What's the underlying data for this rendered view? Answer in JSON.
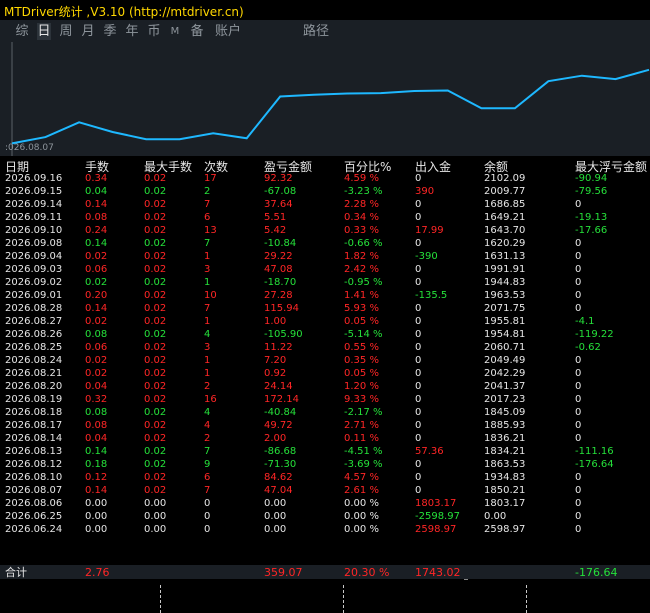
{
  "window": {
    "title": "MTDriver统计 ,V3.10 (http://mtdriver.cn)"
  },
  "tabs": [
    {
      "label": "综",
      "active": false
    },
    {
      "label": "日",
      "active": true
    },
    {
      "label": "周",
      "active": false
    },
    {
      "label": "月",
      "active": false
    },
    {
      "label": "季",
      "active": false
    },
    {
      "label": "年",
      "active": false
    },
    {
      "label": "币",
      "active": false
    },
    {
      "label": "M",
      "active": false
    },
    {
      "label": "备",
      "active": false
    },
    {
      "label": "账户",
      "active": false
    },
    {
      "label": "路径",
      "active": false
    }
  ],
  "chart": {
    "start_label": ":026.08.07",
    "line_color": "#1eb8ff",
    "y_min": -400,
    "y_max": 2200,
    "balance_series": [
      -150,
      0,
      350,
      120,
      -50,
      -50,
      90,
      -30,
      960,
      1000,
      1030,
      1040,
      1090,
      1100,
      680,
      680,
      1320,
      1450,
      1370,
      1590
    ]
  },
  "table": {
    "headers": [
      "日期",
      "手数",
      "最大手数",
      "次数",
      "盈亏金额",
      "百分比%",
      "出入金",
      "余额",
      "最大浮亏金额"
    ],
    "rows": [
      [
        "2026.09.16",
        "0.34",
        "0.02",
        "17",
        "92.32",
        "4.59 %",
        "0",
        "2102.09",
        "-90.94"
      ],
      [
        "2026.09.15",
        "0.04",
        "0.02",
        "2",
        "-67.08",
        "-3.23 %",
        "390",
        "2009.77",
        "-79.56"
      ],
      [
        "2026.09.14",
        "0.14",
        "0.02",
        "7",
        "37.64",
        "2.28 %",
        "0",
        "1686.85",
        "0"
      ],
      [
        "2026.09.11",
        "0.08",
        "0.02",
        "6",
        "5.51",
        "0.34 %",
        "0",
        "1649.21",
        "-19.13"
      ],
      [
        "2026.09.10",
        "0.24",
        "0.02",
        "13",
        "5.42",
        "0.33 %",
        "17.99",
        "1643.70",
        "-17.66"
      ],
      [
        "2026.09.08",
        "0.14",
        "0.02",
        "7",
        "-10.84",
        "-0.66 %",
        "0",
        "1620.29",
        "0"
      ],
      [
        "2026.09.04",
        "0.02",
        "0.02",
        "1",
        "29.22",
        "1.82 %",
        "-390",
        "1631.13",
        "0"
      ],
      [
        "2026.09.03",
        "0.06",
        "0.02",
        "3",
        "47.08",
        "2.42 %",
        "0",
        "1991.91",
        "0"
      ],
      [
        "2026.09.02",
        "0.02",
        "0.02",
        "1",
        "-18.70",
        "-0.95 %",
        "0",
        "1944.83",
        "0"
      ],
      [
        "2026.09.01",
        "0.20",
        "0.02",
        "10",
        "27.28",
        "1.41 %",
        "-135.5",
        "1963.53",
        "0"
      ],
      [
        "2026.08.28",
        "0.14",
        "0.02",
        "7",
        "115.94",
        "5.93 %",
        "0",
        "2071.75",
        "0"
      ],
      [
        "2026.08.27",
        "0.02",
        "0.02",
        "1",
        "1.00",
        "0.05 %",
        "0",
        "1955.81",
        "-4.1"
      ],
      [
        "2026.08.26",
        "0.08",
        "0.02",
        "4",
        "-105.90",
        "-5.14 %",
        "0",
        "1954.81",
        "-119.22"
      ],
      [
        "2026.08.25",
        "0.06",
        "0.02",
        "3",
        "11.22",
        "0.55 %",
        "0",
        "2060.71",
        "-0.62"
      ],
      [
        "2026.08.24",
        "0.02",
        "0.02",
        "1",
        "7.20",
        "0.35 %",
        "0",
        "2049.49",
        "0"
      ],
      [
        "2026.08.21",
        "0.02",
        "0.02",
        "1",
        "0.92",
        "0.05 %",
        "0",
        "2042.29",
        "0"
      ],
      [
        "2026.08.20",
        "0.04",
        "0.02",
        "2",
        "24.14",
        "1.20 %",
        "0",
        "2041.37",
        "0"
      ],
      [
        "2026.08.19",
        "0.32",
        "0.02",
        "16",
        "172.14",
        "9.33 %",
        "0",
        "2017.23",
        "0"
      ],
      [
        "2026.08.18",
        "0.08",
        "0.02",
        "4",
        "-40.84",
        "-2.17 %",
        "0",
        "1845.09",
        "0"
      ],
      [
        "2026.08.17",
        "0.08",
        "0.02",
        "4",
        "49.72",
        "2.71 %",
        "0",
        "1885.93",
        "0"
      ],
      [
        "2026.08.14",
        "0.04",
        "0.02",
        "2",
        "2.00",
        "0.11 %",
        "0",
        "1836.21",
        "0"
      ],
      [
        "2026.08.13",
        "0.14",
        "0.02",
        "7",
        "-86.68",
        "-4.51 %",
        "57.36",
        "1834.21",
        "-111.16"
      ],
      [
        "2026.08.12",
        "0.18",
        "0.02",
        "9",
        "-71.30",
        "-3.69 %",
        "0",
        "1863.53",
        "-176.64"
      ],
      [
        "2026.08.10",
        "0.12",
        "0.02",
        "6",
        "84.62",
        "4.57 %",
        "0",
        "1934.83",
        "0"
      ],
      [
        "2026.08.07",
        "0.14",
        "0.02",
        "7",
        "47.04",
        "2.61 %",
        "0",
        "1850.21",
        "0"
      ],
      [
        "2026.08.06",
        "0.00",
        "0.00",
        "0",
        "0.00",
        "0.00 %",
        "1803.17",
        "1803.17",
        "0"
      ],
      [
        "2026.06.25",
        "0.00",
        "0.00",
        "0",
        "0.00",
        "0.00 %",
        "-2598.97",
        "0.00",
        "0"
      ],
      [
        "2026.06.24",
        "0.00",
        "0.00",
        "0",
        "0.00",
        "0.00 %",
        "2598.97",
        "2598.97",
        "0"
      ]
    ],
    "total": [
      "合计",
      "2.76",
      "",
      "",
      "359.07",
      "20.30 %",
      "1743.02",
      "",
      "-176.64"
    ]
  },
  "colors": {
    "title": "#ffd700",
    "positive": "#25e03a",
    "negative": "#ff2626",
    "neutral": "#e6e6e6",
    "panel": "#1a1f25"
  }
}
